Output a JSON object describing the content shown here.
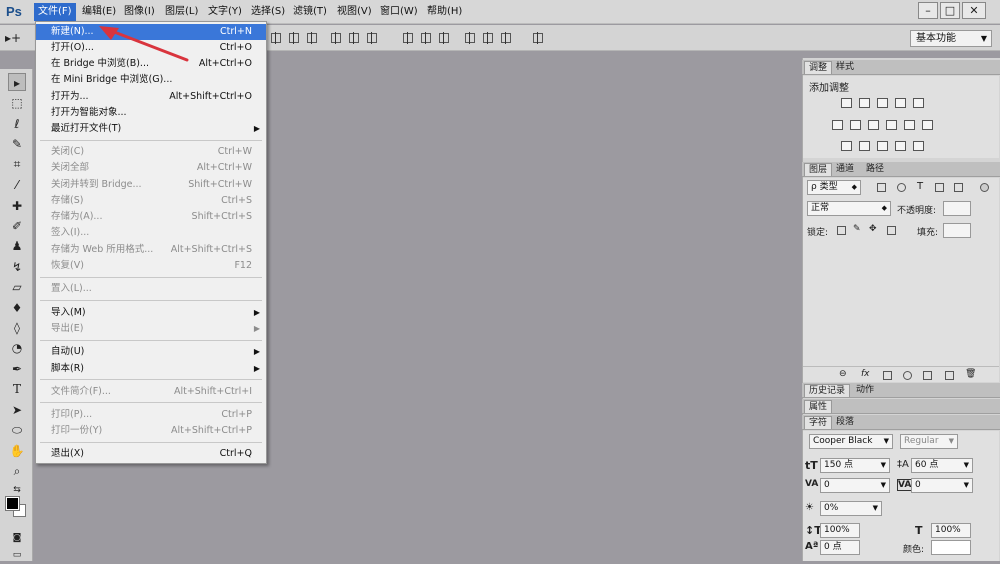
{
  "app": {
    "logo": "Ps"
  },
  "menubar": {
    "items": [
      "文件(F)",
      "编辑(E)",
      "图像(I)",
      "图层(L)",
      "文字(Y)",
      "选择(S)",
      "滤镜(T)",
      "视图(V)",
      "窗口(W)",
      "帮助(H)"
    ],
    "active_index": 0,
    "window_buttons": [
      "–",
      "□",
      "✕"
    ]
  },
  "options_bar": {
    "workspace": "基本功能"
  },
  "file_menu": {
    "items": [
      {
        "label": "新建(N)...",
        "shortcut": "Ctrl+N",
        "state": "highlight"
      },
      {
        "label": "打开(O)...",
        "shortcut": "Ctrl+O",
        "state": "normal"
      },
      {
        "label": "在 Bridge 中浏览(B)...",
        "shortcut": "Alt+Ctrl+O",
        "state": "normal"
      },
      {
        "label": "在 Mini Bridge 中浏览(G)...",
        "shortcut": "",
        "state": "normal"
      },
      {
        "label": "打开为...",
        "shortcut": "Alt+Shift+Ctrl+O",
        "state": "normal"
      },
      {
        "label": "打开为智能对象...",
        "shortcut": "",
        "state": "normal"
      },
      {
        "label": "最近打开文件(T)",
        "shortcut": "",
        "state": "submenu"
      },
      {
        "label": "关闭(C)",
        "shortcut": "Ctrl+W",
        "state": "disabled"
      },
      {
        "label": "关闭全部",
        "shortcut": "Alt+Ctrl+W",
        "state": "disabled"
      },
      {
        "label": "关闭并转到 Bridge...",
        "shortcut": "Shift+Ctrl+W",
        "state": "disabled"
      },
      {
        "label": "存储(S)",
        "shortcut": "Ctrl+S",
        "state": "disabled"
      },
      {
        "label": "存储为(A)...",
        "shortcut": "Shift+Ctrl+S",
        "state": "disabled"
      },
      {
        "label": "签入(I)...",
        "shortcut": "",
        "state": "disabled"
      },
      {
        "label": "存储为 Web 所用格式...",
        "shortcut": "Alt+Shift+Ctrl+S",
        "state": "disabled"
      },
      {
        "label": "恢复(V)",
        "shortcut": "F12",
        "state": "disabled"
      },
      {
        "label": "置入(L)...",
        "shortcut": "",
        "state": "disabled"
      },
      {
        "label": "导入(M)",
        "shortcut": "",
        "state": "submenu"
      },
      {
        "label": "导出(E)",
        "shortcut": "",
        "state": "submenu-disabled"
      },
      {
        "label": "自动(U)",
        "shortcut": "",
        "state": "submenu"
      },
      {
        "label": "脚本(R)",
        "shortcut": "",
        "state": "submenu"
      },
      {
        "label": "文件简介(F)...",
        "shortcut": "Alt+Shift+Ctrl+I",
        "state": "disabled"
      },
      {
        "label": "打印(P)...",
        "shortcut": "Ctrl+P",
        "state": "disabled"
      },
      {
        "label": "打印一份(Y)",
        "shortcut": "Alt+Shift+Ctrl+P",
        "state": "disabled"
      },
      {
        "label": "退出(X)",
        "shortcut": "Ctrl+Q",
        "state": "normal"
      }
    ]
  },
  "adjustments_panel": {
    "tabs": [
      "调整",
      "样式"
    ],
    "title": "添加调整"
  },
  "layers_panel": {
    "tabs": [
      "图层",
      "通道",
      "路径"
    ],
    "filter": "ρ 类型",
    "blend_mode": "正常",
    "opacity_label": "不透明度:",
    "lock_label": "锁定:",
    "fill_label": "填充:"
  },
  "history_panel": {
    "tabs": [
      "历史记录",
      "动作"
    ]
  },
  "properties_panel": {
    "title": "属性"
  },
  "character_panel": {
    "tabs": [
      "字符",
      "段落"
    ],
    "font_family": "Cooper Black",
    "font_style": "Regular",
    "font_size": "150 点",
    "leading": "60 点",
    "kerning": "0",
    "tracking": "0",
    "scale_pct": "0%",
    "vertical_scale": "100%",
    "horizontal_scale": "100%",
    "baseline": "0 点",
    "color_label": "颜色:"
  },
  "colors": {
    "accent": "#3a77d9",
    "canvas": "#9c9aa0",
    "annotation": "#d9343d"
  }
}
